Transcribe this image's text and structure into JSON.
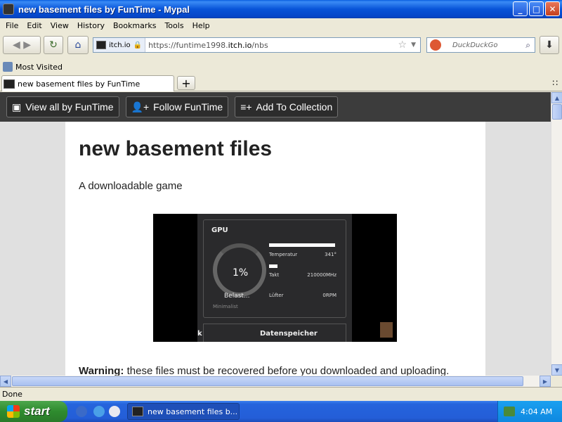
{
  "window": {
    "title": "new basement files by FunTime - Mypal",
    "buttons": {
      "minimize": "_",
      "maximize": "□",
      "close": "✕"
    }
  },
  "menu": [
    "File",
    "Edit",
    "View",
    "History",
    "Bookmarks",
    "Tools",
    "Help"
  ],
  "nav": {
    "site_label": "itch.io",
    "url_prefix": "https://funtime1998.",
    "url_host": "itch.io",
    "url_path": "/nbs",
    "search_placeholder": "DuckDuckGo"
  },
  "bookmarks": {
    "most_visited": "Most Visited"
  },
  "tabs": [
    {
      "label": "new basement files by FunTime"
    }
  ],
  "itch_toolbar": {
    "view_all": "View all by FunTime",
    "follow": "Follow FunTime",
    "add_collection": "Add To Collection"
  },
  "page": {
    "title": "new basement files",
    "subtitle": "A downloadable game",
    "warning_label": "Warning:",
    "warning_text": " these files must be recovered before you downloaded and uploading."
  },
  "screenshot": {
    "gpu_label": "GPU",
    "percent": "1%",
    "load_label": "Belast...",
    "minimalist": "Minimalist",
    "rows": [
      {
        "label": "Temperatur",
        "value": "341°"
      },
      {
        "label": "Takt",
        "value": "210000MHz"
      },
      {
        "label": "Lüfter",
        "value": "0RPM"
      }
    ],
    "bottom_left": "k",
    "bottom_right": "Datenspeicher"
  },
  "status": {
    "text": "Done"
  },
  "taskbar": {
    "start": "start",
    "task_item": "new basement files b...",
    "clock": "4:04 AM"
  }
}
